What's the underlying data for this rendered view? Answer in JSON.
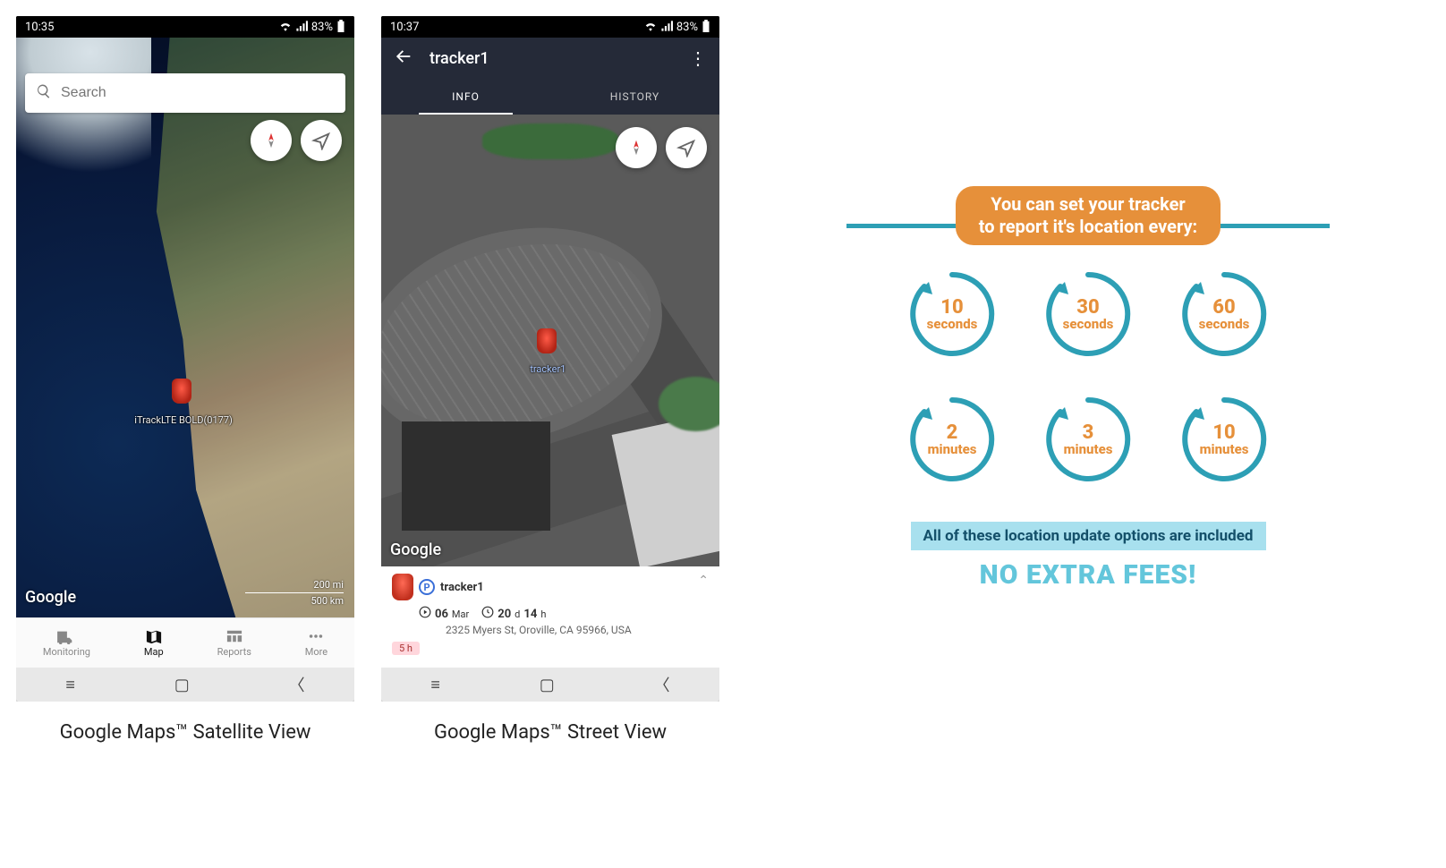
{
  "phone1": {
    "status": {
      "time": "10:35",
      "battery": "83%"
    },
    "search": {
      "placeholder": "Search"
    },
    "marker": {
      "label": "iTrackLTE BOLD(0177)"
    },
    "attrib": "Google",
    "scale": {
      "mi": "200 mi",
      "km": "500 km"
    },
    "nav": {
      "monitoring": "Monitoring",
      "map": "Map",
      "reports": "Reports",
      "more": "More"
    }
  },
  "phone2": {
    "status": {
      "time": "10:37",
      "battery": "83%"
    },
    "topbar": {
      "title": "tracker1"
    },
    "tabs": {
      "info": "INFO",
      "history": "HISTORY"
    },
    "marker": {
      "label": "tracker1"
    },
    "attrib": "Google",
    "card": {
      "name": "tracker1",
      "date_num": "06",
      "date_mon": "Mar",
      "dur_days": "20",
      "dur_d": "d",
      "dur_hours": "14",
      "dur_h": "h",
      "addr": "2325 Myers St, Oroville, CA 95966, USA",
      "chip": "5 h"
    }
  },
  "captions": {
    "satellite": "Google Maps™ Satellite View",
    "street": "Google Maps™ Street View"
  },
  "infographic": {
    "headline1": "You can set your tracker",
    "headline2": "to report it's location every:",
    "options": [
      {
        "num": "10",
        "unit": "seconds"
      },
      {
        "num": "30",
        "unit": "seconds"
      },
      {
        "num": "60",
        "unit": "seconds"
      },
      {
        "num": "2",
        "unit": "minutes"
      },
      {
        "num": "3",
        "unit": "minutes"
      },
      {
        "num": "10",
        "unit": "minutes"
      }
    ],
    "sub": "All of these location update options are included",
    "noextra": "NO EXTRA FEES!"
  }
}
